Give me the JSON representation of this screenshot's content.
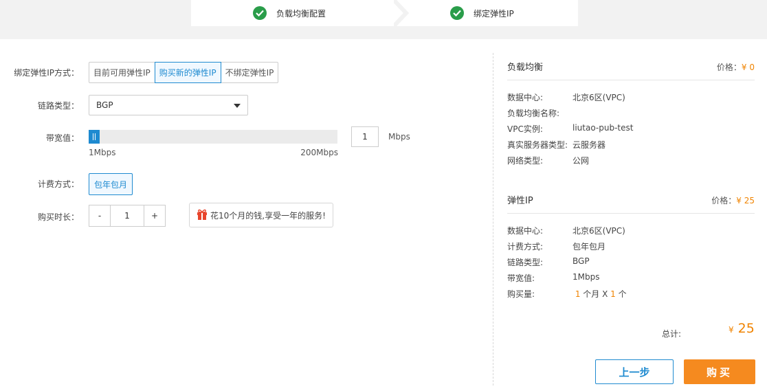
{
  "steps": [
    {
      "label": "负载均衡配置",
      "icon": "check-circle-icon",
      "done": true
    },
    {
      "label": "绑定弹性IP",
      "icon": "check-circle-icon",
      "done": true
    }
  ],
  "form": {
    "bind_method": {
      "label": "绑定弹性IP方式：",
      "options": [
        "目前可用弹性IP",
        "购买新的弹性IP",
        "不绑定弹性IP"
      ],
      "selected": "购买新的弹性IP"
    },
    "line_type": {
      "label": "链路类型：",
      "value": "BGP"
    },
    "bandwidth": {
      "label": "带宽值：",
      "min_label": "1Mbps",
      "max_label": "200Mbps",
      "min": 1,
      "max": 200,
      "value": "1",
      "unit": "Mbps"
    },
    "billing": {
      "label": "计费方式：",
      "value": "包年包月"
    },
    "duration": {
      "label": "购买时长：",
      "minus": "-",
      "value": "1",
      "plus": "+"
    },
    "promo": {
      "icon": "gift-icon",
      "text": "花10个月的钱,享受一年的服务!"
    }
  },
  "summary": {
    "lb": {
      "title": "负载均衡",
      "price_label": "价格：",
      "price": "¥ 0",
      "rows": [
        {
          "k": "数据中心:",
          "v": "北京6区(VPC)"
        },
        {
          "k": "负载均衡名称:",
          "v": ""
        },
        {
          "k": "VPC实例:",
          "v": "liutao-pub-test"
        },
        {
          "k": "真实服务器类型:",
          "v": "云服务器"
        },
        {
          "k": "网络类型:",
          "v": "公网"
        }
      ]
    },
    "eip": {
      "title": "弹性IP",
      "price_label": "价格：",
      "price": "¥ 25",
      "rows": [
        {
          "k": "数据中心:",
          "v": "北京6区(VPC)"
        },
        {
          "k": "计费方式:",
          "v": "包年包月"
        },
        {
          "k": "链路类型:",
          "v": "BGP"
        },
        {
          "k": "带宽值:",
          "v": "1Mbps"
        }
      ],
      "qty": {
        "k": "购买量:",
        "n1": "1",
        "t1": " 个月 X ",
        "n2": "1",
        "t2": " 个"
      }
    },
    "total_label": "总计:",
    "currency": "¥",
    "total": "25"
  },
  "buttons": {
    "prev": "上一步",
    "buy": "购买"
  },
  "colors": {
    "accent": "#1e8ad0",
    "success": "#2a9d4a",
    "price": "#f08300",
    "buy": "#f58a1f"
  }
}
